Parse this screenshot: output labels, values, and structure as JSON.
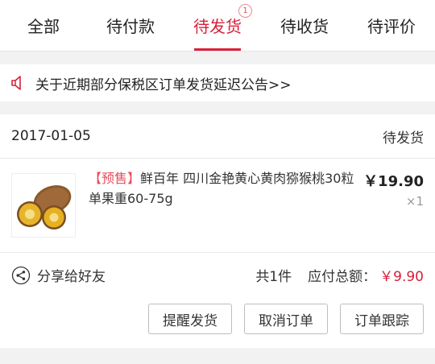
{
  "tabs": [
    {
      "label": "全部",
      "active": false
    },
    {
      "label": "待付款",
      "active": false
    },
    {
      "label": "待发货",
      "active": true,
      "badge": "1"
    },
    {
      "label": "待收货",
      "active": false
    },
    {
      "label": "待评价",
      "active": false
    }
  ],
  "notice": {
    "icon": "speaker-icon",
    "text": "关于近期部分保税区订单发货延迟公告>>"
  },
  "order": {
    "date": "2017-01-05",
    "status": "待发货",
    "item": {
      "tag": "【预售】",
      "name": "鲜百年 四川金艳黄心黄肉猕猴桃30粒 单果重60-75g",
      "price": "￥19.90",
      "qty": "×1"
    },
    "summary": {
      "share_label": "分享给好友",
      "count": "共1件",
      "total_label": "应付总额：",
      "total": "￥9.90"
    },
    "actions": {
      "remind": "提醒发货",
      "cancel": "取消订单",
      "track": "订单跟踪"
    }
  },
  "colors": {
    "accent": "#d8203a",
    "tag": "#e84c5b",
    "background": "#f2f2f2"
  }
}
